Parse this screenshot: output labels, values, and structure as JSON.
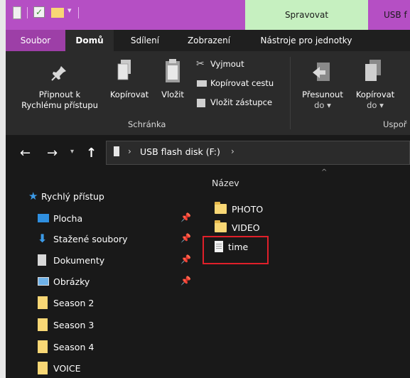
{
  "window": {
    "title_partial": "USB f",
    "contextual_tab": "Spravovat",
    "accent_color": "#b54fc4"
  },
  "tabs": {
    "soubor": "Soubor",
    "domu": "Domů",
    "sdileni": "Sdílení",
    "zobrazeni": "Zobrazení",
    "nastroje": "Nástroje pro jednotky"
  },
  "ribbon": {
    "pripnout_1": "Připnout k",
    "pripnout_2": "Rychlému přístupu",
    "kopirovat": "Kopírovat",
    "vlozit": "Vložit",
    "vyjmout": "Vyjmout",
    "kopirovat_cestu": "Kopírovat cestu",
    "vlozit_zastupce": "Vložit zástupce",
    "presunout_1": "Přesunout",
    "presunout_2": "do ▾",
    "kopirovat_do_1": "Kopírovat",
    "kopirovat_do_2": "do ▾",
    "group_schranka": "Schránka",
    "group_usporadat": "Uspoř"
  },
  "address": {
    "path_label": "USB flash disk (F:)"
  },
  "nav": {
    "quick_access": "Rychlý přístup",
    "items": [
      "Plocha",
      "Stažené soubory",
      "Dokumenty",
      "Obrázky",
      "Season 2",
      "Season 3",
      "Season 4",
      "VOICE"
    ]
  },
  "content": {
    "column_name": "Název",
    "files": [
      "PHOTO",
      "VIDEO",
      "time"
    ]
  }
}
